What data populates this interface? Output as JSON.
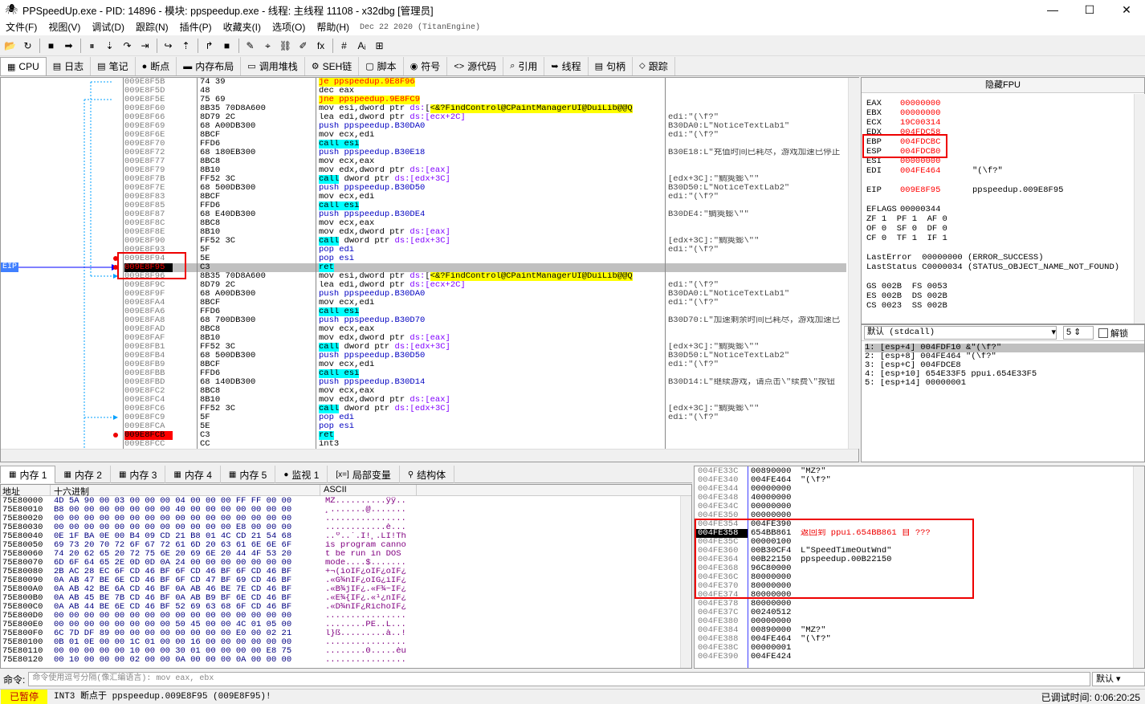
{
  "window": {
    "title": "PPSpeedUp.exe - PID: 14896 - 模块: ppspeedup.exe - 线程: 主线程 11108 - x32dbg [管理员]",
    "minimize": "—",
    "maximize": "☐",
    "close": "✕"
  },
  "menu": {
    "items": [
      "文件(F)",
      "视图(V)",
      "调试(D)",
      "跟踪(N)",
      "插件(P)",
      "收藏夹(I)",
      "选项(O)",
      "帮助(H)"
    ],
    "build_date": "Dec 22 2020 (TitanEngine)"
  },
  "toolbar": {
    "buttons": [
      "📂",
      "↻",
      "■",
      "➡",
      "⏸",
      "⇣",
      "↷",
      "⇥",
      "↪",
      "⇡",
      "↱",
      "■",
      "✎",
      "⌖",
      "⛓",
      "✐",
      "fx",
      "#",
      "Aᵢ",
      "⊞"
    ]
  },
  "tabs": [
    {
      "label": "CPU",
      "icon": "▦",
      "active": true
    },
    {
      "label": "日志",
      "icon": "▤"
    },
    {
      "label": "笔记",
      "icon": "▤"
    },
    {
      "label": "断点",
      "icon": "●"
    },
    {
      "label": "内存布局",
      "icon": "▬"
    },
    {
      "label": "调用堆栈",
      "icon": "▭"
    },
    {
      "label": "SEH链",
      "icon": "⚙"
    },
    {
      "label": "脚本",
      "icon": "▢"
    },
    {
      "label": "符号",
      "icon": "◉"
    },
    {
      "label": "源代码",
      "icon": "<>"
    },
    {
      "label": "引用",
      "icon": "⌕"
    },
    {
      "label": "线程",
      "icon": "➥"
    },
    {
      "label": "句柄",
      "icon": "▤"
    },
    {
      "label": "跟踪",
      "icon": "⬦"
    }
  ],
  "cpu": {
    "eip_label": "EIP",
    "rows": [
      {
        "addr": "009E8F5B",
        "bytes": "74 39",
        "dis": [
          [
            "jmp",
            "je ppspeedup.9E8F96"
          ]
        ],
        "cmt": ""
      },
      {
        "addr": "009E8F5D",
        "bytes": "48",
        "dis": [
          [
            "mov",
            "dec eax"
          ]
        ],
        "cmt": ""
      },
      {
        "addr": "009E8F5E",
        "bytes": "75 69",
        "dis": [
          [
            "jmp",
            "jne ppspeedup.9E8FC9"
          ]
        ],
        "cmt": ""
      },
      {
        "addr": "009E8F60",
        "bytes": "8B35 70D8A600",
        "dis": [
          [
            "mov",
            "mov esi,dword ptr "
          ],
          [
            "ds",
            "ds:"
          ],
          [
            "mov",
            "["
          ],
          [
            "lbl",
            "<&?FindControl@CPaintManagerUI@DuiLib@@Q"
          ]
        ],
        "cmt": ""
      },
      {
        "addr": "009E8F66",
        "bytes": "8D79 2C",
        "dis": [
          [
            "mov",
            "lea edi,dword ptr "
          ],
          [
            "ds",
            "ds:[ecx+2C]"
          ]
        ],
        "cmt": "edi:\"(\\f?\""
      },
      {
        "addr": "009E8F69",
        "bytes": "68 A00DB300",
        "dis": [
          [
            "push",
            "push ppspeedup.B30DA0"
          ]
        ],
        "cmt": "B30DA0:L\"NoticeTextLab1\""
      },
      {
        "addr": "009E8F6E",
        "bytes": "8BCF",
        "dis": [
          [
            "mov",
            "mov ecx,edi"
          ]
        ],
        "cmt": "edi:\"(\\f?\""
      },
      {
        "addr": "009E8F70",
        "bytes": "FFD6",
        "dis": [
          [
            "call",
            "call esi"
          ]
        ],
        "cmt": ""
      },
      {
        "addr": "009E8F72",
        "bytes": "68 180EB300",
        "dis": [
          [
            "push",
            "push ppspeedup.B30E18"
          ]
        ],
        "cmt": "B30E18:L\"充值时间已耗尽，游戏加速已停止"
      },
      {
        "addr": "009E8F77",
        "bytes": "8BC8",
        "dis": [
          [
            "mov",
            "mov ecx,eax"
          ]
        ],
        "cmt": ""
      },
      {
        "addr": "009E8F79",
        "bytes": "8B10",
        "dis": [
          [
            "mov",
            "mov edx,dword ptr "
          ],
          [
            "ds",
            "ds:[eax]"
          ]
        ],
        "cmt": ""
      },
      {
        "addr": "009E8F7B",
        "bytes": "FF52 3C",
        "dis": [
          [
            "call",
            "call"
          ],
          [
            "mov",
            " dword ptr "
          ],
          [
            "ds",
            "ds:[edx+3C]"
          ]
        ],
        "cmt": "[edx+3C]:\"鲷筴蟛\\\"\""
      },
      {
        "addr": "009E8F7E",
        "bytes": "68 500DB300",
        "dis": [
          [
            "push",
            "push ppspeedup.B30D50"
          ]
        ],
        "cmt": "B30D50:L\"NoticeTextLab2\""
      },
      {
        "addr": "009E8F83",
        "bytes": "8BCF",
        "dis": [
          [
            "mov",
            "mov ecx,edi"
          ]
        ],
        "cmt": "edi:\"(\\f?\""
      },
      {
        "addr": "009E8F85",
        "bytes": "FFD6",
        "dis": [
          [
            "call",
            "call esi"
          ]
        ],
        "cmt": ""
      },
      {
        "addr": "009E8F87",
        "bytes": "68 E40DB300",
        "dis": [
          [
            "push",
            "push ppspeedup.B30DE4"
          ]
        ],
        "cmt": "B30DE4:\"鲷筴蟛\\\"\""
      },
      {
        "addr": "009E8F8C",
        "bytes": "8BC8",
        "dis": [
          [
            "mov",
            "mov ecx,eax"
          ]
        ],
        "cmt": ""
      },
      {
        "addr": "009E8F8E",
        "bytes": "8B10",
        "dis": [
          [
            "mov",
            "mov edx,dword ptr "
          ],
          [
            "ds",
            "ds:[eax]"
          ]
        ],
        "cmt": ""
      },
      {
        "addr": "009E8F90",
        "bytes": "FF52 3C",
        "dis": [
          [
            "call",
            "call"
          ],
          [
            "mov",
            " dword ptr "
          ],
          [
            "ds",
            "ds:[edx+3C]"
          ]
        ],
        "cmt": "[edx+3C]:\"鲷筴蟛\\\"\""
      },
      {
        "addr": "009E8F93",
        "bytes": "5F",
        "dis": [
          [
            "pop",
            "pop edi"
          ]
        ],
        "cmt": "edi:\"(\\f?\""
      },
      {
        "addr": "009E8F94",
        "bytes": "5E",
        "dis": [
          [
            "pop",
            "pop esi"
          ]
        ],
        "cmt": ""
      },
      {
        "addr": "009E8F95",
        "bytes": "C3",
        "dis": [
          [
            "ret",
            "ret"
          ]
        ],
        "cmt": ""
      },
      {
        "addr": "009E8F96",
        "bytes": "8B35 70D8A600",
        "dis": [
          [
            "mov",
            "mov esi,dword ptr "
          ],
          [
            "ds",
            "ds:"
          ],
          [
            "mov",
            "["
          ],
          [
            "lbl",
            "<&?FindControl@CPaintManagerUI@DuiLib@@Q"
          ]
        ],
        "cmt": ""
      },
      {
        "addr": "009E8F9C",
        "bytes": "8D79 2C",
        "dis": [
          [
            "mov",
            "lea edi,dword ptr "
          ],
          [
            "ds",
            "ds:[ecx+2C]"
          ]
        ],
        "cmt": "edi:\"(\\f?\""
      },
      {
        "addr": "009E8F9F",
        "bytes": "68 A00DB300",
        "dis": [
          [
            "push",
            "push ppspeedup.B30DA0"
          ]
        ],
        "cmt": "B30DA0:L\"NoticeTextLab1\""
      },
      {
        "addr": "009E8FA4",
        "bytes": "8BCF",
        "dis": [
          [
            "mov",
            "mov ecx,edi"
          ]
        ],
        "cmt": "edi:\"(\\f?\""
      },
      {
        "addr": "009E8FA6",
        "bytes": "FFD6",
        "dis": [
          [
            "call",
            "call esi"
          ]
        ],
        "cmt": ""
      },
      {
        "addr": "009E8FA8",
        "bytes": "68 700DB300",
        "dis": [
          [
            "push",
            "push ppspeedup.B30D70"
          ]
        ],
        "cmt": "B30D70:L\"加速剩余时间已耗尽，游戏加速已"
      },
      {
        "addr": "009E8FAD",
        "bytes": "8BC8",
        "dis": [
          [
            "mov",
            "mov ecx,eax"
          ]
        ],
        "cmt": ""
      },
      {
        "addr": "009E8FAF",
        "bytes": "8B10",
        "dis": [
          [
            "mov",
            "mov edx,dword ptr "
          ],
          [
            "ds",
            "ds:[eax]"
          ]
        ],
        "cmt": ""
      },
      {
        "addr": "009E8FB1",
        "bytes": "FF52 3C",
        "dis": [
          [
            "call",
            "call"
          ],
          [
            "mov",
            " dword ptr "
          ],
          [
            "ds",
            "ds:[edx+3C]"
          ]
        ],
        "cmt": "[edx+3C]:\"鲷筴蟛\\\"\""
      },
      {
        "addr": "009E8FB4",
        "bytes": "68 500DB300",
        "dis": [
          [
            "push",
            "push ppspeedup.B30D50"
          ]
        ],
        "cmt": "B30D50:L\"NoticeTextLab2\""
      },
      {
        "addr": "009E8FB9",
        "bytes": "8BCF",
        "dis": [
          [
            "mov",
            "mov ecx,edi"
          ]
        ],
        "cmt": "edi:\"(\\f?\""
      },
      {
        "addr": "009E8FBB",
        "bytes": "FFD6",
        "dis": [
          [
            "call",
            "call esi"
          ]
        ],
        "cmt": ""
      },
      {
        "addr": "009E8FBD",
        "bytes": "68 140DB300",
        "dis": [
          [
            "push",
            "push ppspeedup.B30D14"
          ]
        ],
        "cmt": "B30D14:L\"继续游戏，请点击\\\"续费\\\"按钮"
      },
      {
        "addr": "009E8FC2",
        "bytes": "8BC8",
        "dis": [
          [
            "mov",
            "mov ecx,eax"
          ]
        ],
        "cmt": ""
      },
      {
        "addr": "009E8FC4",
        "bytes": "8B10",
        "dis": [
          [
            "mov",
            "mov edx,dword ptr "
          ],
          [
            "ds",
            "ds:[eax]"
          ]
        ],
        "cmt": ""
      },
      {
        "addr": "009E8FC6",
        "bytes": "FF52 3C",
        "dis": [
          [
            "call",
            "call"
          ],
          [
            "mov",
            " dword ptr "
          ],
          [
            "ds",
            "ds:[edx+3C]"
          ]
        ],
        "cmt": "[edx+3C]:\"鲷筴蟛\\\"\""
      },
      {
        "addr": "009E8FC9",
        "bytes": "5F",
        "dis": [
          [
            "pop",
            "pop edi"
          ]
        ],
        "cmt": "edi:\"(\\f?\""
      },
      {
        "addr": "009E8FCA",
        "bytes": "5E",
        "dis": [
          [
            "pop",
            "pop esi"
          ]
        ],
        "cmt": ""
      },
      {
        "addr": "009E8FCB",
        "bytes": "C3",
        "dis": [
          [
            "ret",
            "ret"
          ]
        ],
        "cmt": ""
      },
      {
        "addr": "009E8FCC",
        "bytes": "CC",
        "dis": [
          [
            "mov",
            "int3"
          ]
        ],
        "cmt": ""
      }
    ]
  },
  "registers": {
    "header": "隐藏FPU",
    "lines": [
      {
        "n": "EAX",
        "v": "00000000",
        "c": ""
      },
      {
        "n": "EBX",
        "v": "00000000",
        "c": ""
      },
      {
        "n": "ECX",
        "v": "19C00314",
        "c": ""
      },
      {
        "n": "EDX",
        "v": "004FDC58",
        "c": ""
      },
      {
        "n": "EBP",
        "v": "004FDCBC",
        "c": ""
      },
      {
        "n": "ESP",
        "v": "004FDCB0",
        "c": ""
      },
      {
        "n": "ESI",
        "v": "00000000",
        "c": ""
      },
      {
        "n": "EDI",
        "v": "004FE464",
        "c": "\"(\\f?\""
      },
      {
        "n": "",
        "v": "",
        "c": ""
      },
      {
        "n": "EIP",
        "v": "009E8F95",
        "c": "ppspeedup.009E8F95"
      },
      {
        "n": "",
        "v": "",
        "c": ""
      },
      {
        "n": "EFLAGS",
        "v": "00000344",
        "c": ""
      }
    ],
    "flags": [
      "ZF 1  PF 1  AF 0",
      "OF 0  SF 0  DF 0",
      "CF 0  TF 1  IF 1"
    ],
    "last_error": "LastError  00000000 (ERROR_SUCCESS)",
    "last_status": "LastStatus C0000034 (STATUS_OBJECT_NAME_NOT_FOUND)",
    "segs": [
      "GS 002B  FS 0053",
      "ES 002B  DS 002B",
      "CS 0023  SS 002B"
    ]
  },
  "callconv": {
    "select": "默认 (stdcall)",
    "count": "5",
    "unlock_label": "解锁",
    "args": [
      "1: [esp+4] 004FDF10 &\"(\\f?\"",
      "2: [esp+8] 004FE464 \"(\\f?\"",
      "3: [esp+C] 004FDCE8",
      "4: [esp+10] 654E33F5 ppui.654E33F5",
      "5: [esp+14] 00000001"
    ]
  },
  "dump_tabs": [
    {
      "label": "内存 1",
      "icon": "▦",
      "active": true
    },
    {
      "label": "内存 2",
      "icon": "▦"
    },
    {
      "label": "内存 3",
      "icon": "▦"
    },
    {
      "label": "内存 4",
      "icon": "▦"
    },
    {
      "label": "内存 5",
      "icon": "▦"
    },
    {
      "label": "监视 1",
      "icon": "●"
    },
    {
      "label": "局部变量",
      "icon": "[x=]"
    },
    {
      "label": "结构体",
      "icon": "⚲"
    }
  ],
  "dump": {
    "col_addr": "地址",
    "col_hex": "十六进制",
    "col_ascii": "ASCII",
    "rows": [
      {
        "a": "75E80000",
        "h": "4D 5A 90 00 03 00 00 00 04 00 00 00 FF FF 00 00",
        "s": "MZ..........ÿÿ.."
      },
      {
        "a": "75E80010",
        "h": "B8 00 00 00 00 00 00 00 40 00 00 00 00 00 00 00",
        "s": "¸.......@......."
      },
      {
        "a": "75E80020",
        "h": "00 00 00 00 00 00 00 00 00 00 00 00 00 00 00 00",
        "s": "................"
      },
      {
        "a": "75E80030",
        "h": "00 00 00 00 00 00 00 00 00 00 00 00 E8 00 00 00",
        "s": "............è..."
      },
      {
        "a": "75E80040",
        "h": "0E 1F BA 0E 00 B4 09 CD 21 B8 01 4C CD 21 54 68",
        "s": "..º..´.Í!¸.LÍ!Th"
      },
      {
        "a": "75E80050",
        "h": "69 73 20 70 72 6F 67 72 61 6D 20 63 61 6E 6E 6F",
        "s": "is program canno"
      },
      {
        "a": "75E80060",
        "h": "74 20 62 65 20 72 75 6E 20 69 6E 20 44 4F 53 20",
        "s": "t be run in DOS "
      },
      {
        "a": "75E80070",
        "h": "6D 6F 64 65 2E 0D 0D 0A 24 00 00 00 00 00 00 00",
        "s": "mode....$......."
      },
      {
        "a": "75E80080",
        "h": "2B AC 28 EC 6F CD 46 BF 6F CD 46 BF 6F CD 46 BF",
        "s": "+¬(ìoÍF¿oÍF¿oÍF¿"
      },
      {
        "a": "75E80090",
        "h": "0A AB 47 BE 6E CD 46 BF 6F CD 47 BF 69 CD 46 BF",
        "s": ".«G¾nÍF¿oÍG¿iÍF¿"
      },
      {
        "a": "75E800A0",
        "h": "0A AB 42 BE 6A CD 46 BF 0A AB 46 BE 7E CD 46 BF",
        "s": ".«B¾jÍF¿.«F¾~ÍF¿"
      },
      {
        "a": "75E800B0",
        "h": "0A AB 45 BE 7B CD 46 BF 0A AB B9 BF 6E CD 46 BF",
        "s": ".«E¾{ÍF¿.«¹¿nÍF¿"
      },
      {
        "a": "75E800C0",
        "h": "0A AB 44 BE 6E CD 46 BF 52 69 63 68 6F CD 46 BF",
        "s": ".«D¾nÍF¿RichoÍF¿"
      },
      {
        "a": "75E800D0",
        "h": "00 00 00 00 00 00 00 00 00 00 00 00 00 00 00 00",
        "s": "................"
      },
      {
        "a": "75E800E0",
        "h": "00 00 00 00 00 00 00 00 50 45 00 00 4C 01 05 00",
        "s": "........PE..L..."
      },
      {
        "a": "75E800F0",
        "h": "6C 7D DF 89 00 00 00 00 00 00 00 00 E0 00 02 21",
        "s": "l}ß.........à..!"
      },
      {
        "a": "75E80100",
        "h": "0B 01 0E 00 00 1C 01 00 00 16 00 00 00 00 00 00",
        "s": "................"
      },
      {
        "a": "75E80110",
        "h": "00 00 00 00 00 10 00 00 30 01 00 00 00 00 E8 75",
        "s": "........0.....èu"
      },
      {
        "a": "75E80120",
        "h": "00 10 00 00 00 02 00 00 0A 00 00 00 0A 00 00 00",
        "s": "................"
      }
    ]
  },
  "stack": {
    "rows": [
      {
        "a": "004FE33C",
        "v": "00890000",
        "c": "\"MZ?\""
      },
      {
        "a": "004FE340",
        "v": "004FE464",
        "c": "\"(\\f?\""
      },
      {
        "a": "004FE344",
        "v": "00000000",
        "c": ""
      },
      {
        "a": "004FE348",
        "v": "40000000",
        "c": ""
      },
      {
        "a": "004FE34C",
        "v": "00000000",
        "c": ""
      },
      {
        "a": "004FE350",
        "v": "00000000",
        "c": ""
      },
      {
        "a": "004FE354",
        "v": "004FE390",
        "c": ""
      },
      {
        "a": "004FE358",
        "v": "654BB861",
        "c": "返回到 ppui.654BB861 自 ???"
      },
      {
        "a": "004FE35C",
        "v": "00000100",
        "c": ""
      },
      {
        "a": "004FE360",
        "v": "00B30CF4",
        "c": "L\"SpeedTimeOutWnd\""
      },
      {
        "a": "004FE364",
        "v": "00B22150",
        "c": "ppspeedup.00B22150"
      },
      {
        "a": "004FE368",
        "v": "96C80000",
        "c": ""
      },
      {
        "a": "004FE36C",
        "v": "80000000",
        "c": ""
      },
      {
        "a": "004FE370",
        "v": "80000000",
        "c": ""
      },
      {
        "a": "004FE374",
        "v": "80000000",
        "c": ""
      },
      {
        "a": "004FE378",
        "v": "80000000",
        "c": ""
      },
      {
        "a": "004FE37C",
        "v": "00240512",
        "c": ""
      },
      {
        "a": "004FE380",
        "v": "00000000",
        "c": ""
      },
      {
        "a": "004FE384",
        "v": "00890000",
        "c": "\"MZ?\""
      },
      {
        "a": "004FE388",
        "v": "004FE464",
        "c": "\"(\\f?\""
      },
      {
        "a": "004FE38C",
        "v": "00000001",
        "c": ""
      },
      {
        "a": "004FE390",
        "v": "004FE424",
        "c": ""
      }
    ]
  },
  "command": {
    "label": "命令:",
    "placeholder": "命令使用逗号分隔(像汇编语言): mov eax, ebx",
    "default_label": "默认"
  },
  "status": {
    "state": "已暂停",
    "message": "INT3 断点于 ppspeedup.009E8F95 (009E8F95)!",
    "time": "已调试时间:  0:06:20:25"
  },
  "colors": {
    "eip_bg": "#c0c0c0",
    "paused": "#ffff00",
    "red": "#ff0000",
    "cyan": "#00ffff",
    "yellow": "#ffff00"
  }
}
